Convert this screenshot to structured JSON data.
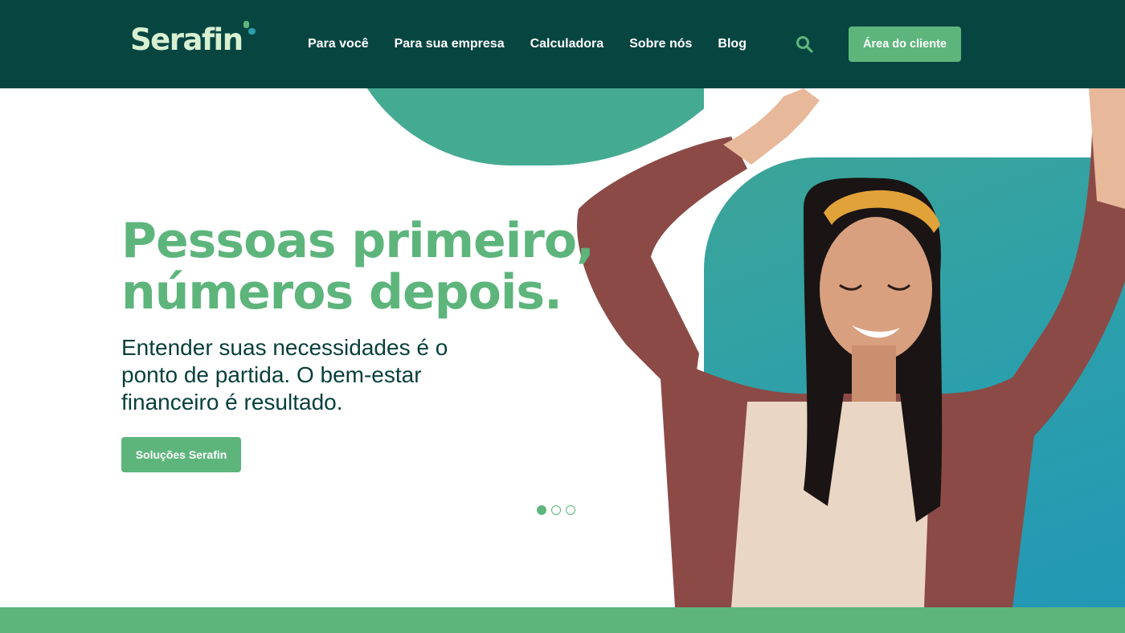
{
  "brand": {
    "name": "Serafin",
    "colors": {
      "header_bg": "#074541",
      "accent": "#5db57c",
      "title": "#5db57c",
      "body_text": "#073f3b",
      "teal": "#2b9fac"
    }
  },
  "header": {
    "nav": [
      {
        "label": "Para você"
      },
      {
        "label": "Para sua empresa"
      },
      {
        "label": "Calculadora"
      },
      {
        "label": "Sobre nós"
      },
      {
        "label": "Blog"
      }
    ],
    "search_icon": "search-icon",
    "client_button": "Área do cliente"
  },
  "hero": {
    "title_line1": "Pessoas primeiro,",
    "title_line2": "números depois.",
    "subtitle": "Entender suas necessidades é o ponto de partida. O bem-estar financeiro é resultado.",
    "cta": "Soluções Serafin",
    "carousel": {
      "total": 3,
      "active": 1
    }
  }
}
